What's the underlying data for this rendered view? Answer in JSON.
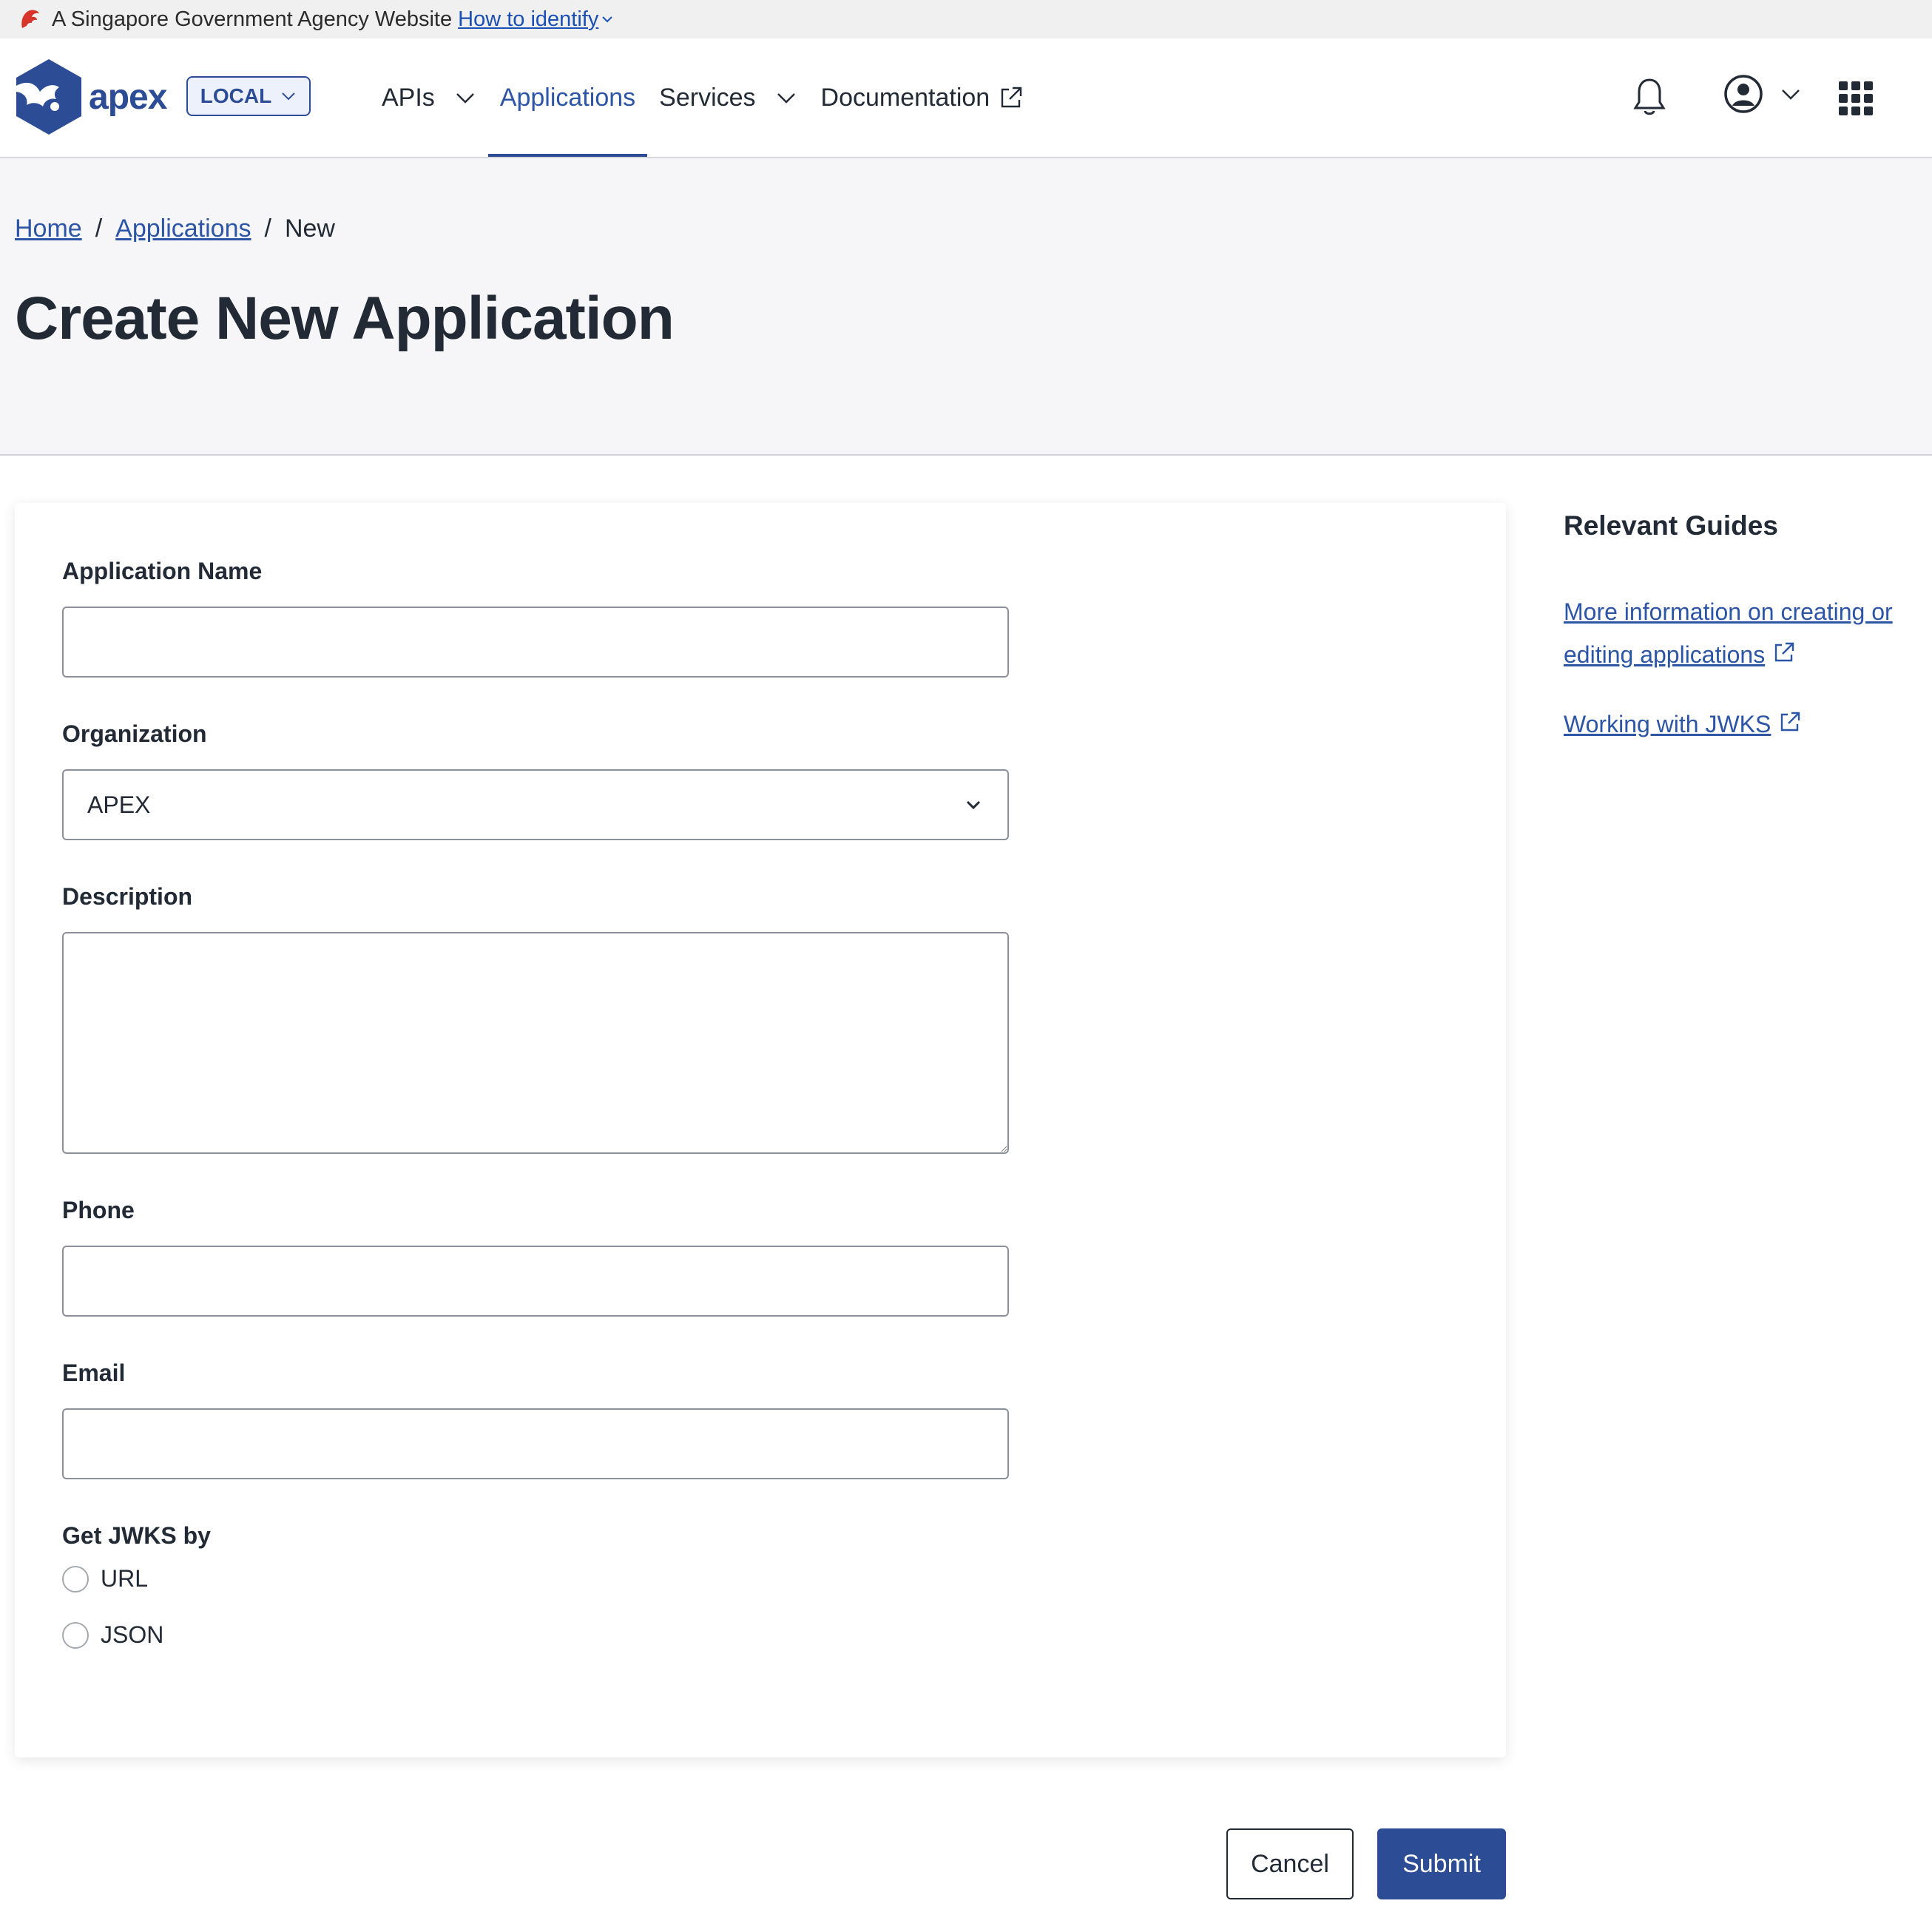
{
  "masthead": {
    "text": "A Singapore Government Agency Website",
    "link": "How to identify"
  },
  "header": {
    "logo_text": "apex",
    "env_badge": "LOCAL",
    "nav": [
      {
        "label": "APIs",
        "has_dropdown": true
      },
      {
        "label": "Applications",
        "active": true
      },
      {
        "label": "Services",
        "has_dropdown": true
      },
      {
        "label": "Documentation",
        "external": true
      }
    ],
    "icons": [
      "bell-icon",
      "user-avatar-icon",
      "apps-grid-icon"
    ]
  },
  "breadcrumb": {
    "home": "Home",
    "applications": "Applications",
    "current": "New",
    "separator": "/"
  },
  "page_title": "Create New Application",
  "form": {
    "app_name_label": "Application Name",
    "app_name_value": "",
    "org_label": "Organization",
    "org_value": "APEX",
    "desc_label": "Description",
    "desc_value": "",
    "phone_label": "Phone",
    "phone_value": "",
    "email_label": "Email",
    "email_value": "",
    "jwks_label": "Get JWKS by",
    "jwks_options": [
      "URL",
      "JSON"
    ]
  },
  "guides": {
    "title": "Relevant Guides",
    "links": [
      "More information on creating or editing applications",
      "Working with JWKS"
    ]
  },
  "buttons": {
    "cancel": "Cancel",
    "submit": "Submit"
  },
  "colors": {
    "brand": "#2c4d96",
    "link": "#2c55a6",
    "text": "#222a35",
    "hero_bg": "#f6f6f8"
  }
}
